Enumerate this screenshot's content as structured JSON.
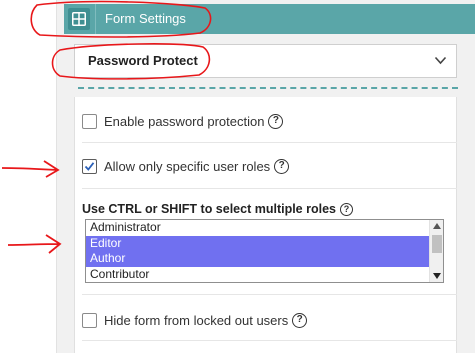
{
  "header": {
    "title": "Form Settings",
    "icon": "grid-icon",
    "color": "#5aa6a8"
  },
  "select": {
    "value": "Password Protect",
    "icon": "chevron-down-icon"
  },
  "options": {
    "enable_password": {
      "label": "Enable password protection",
      "checked": false
    },
    "allow_roles": {
      "label": "Allow only specific user roles",
      "checked": true
    },
    "roles_hint": "Use CTRL or SHIFT to select multiple roles",
    "hide_locked": {
      "label": "Hide form from locked out users",
      "checked": false
    }
  },
  "roles": {
    "items": [
      {
        "label": "Administrator",
        "selected": false
      },
      {
        "label": "Editor",
        "selected": true
      },
      {
        "label": "Author",
        "selected": true
      },
      {
        "label": "Contributor",
        "selected": false
      }
    ]
  },
  "help_glyph": "?",
  "annotation_color": "#e8171a"
}
